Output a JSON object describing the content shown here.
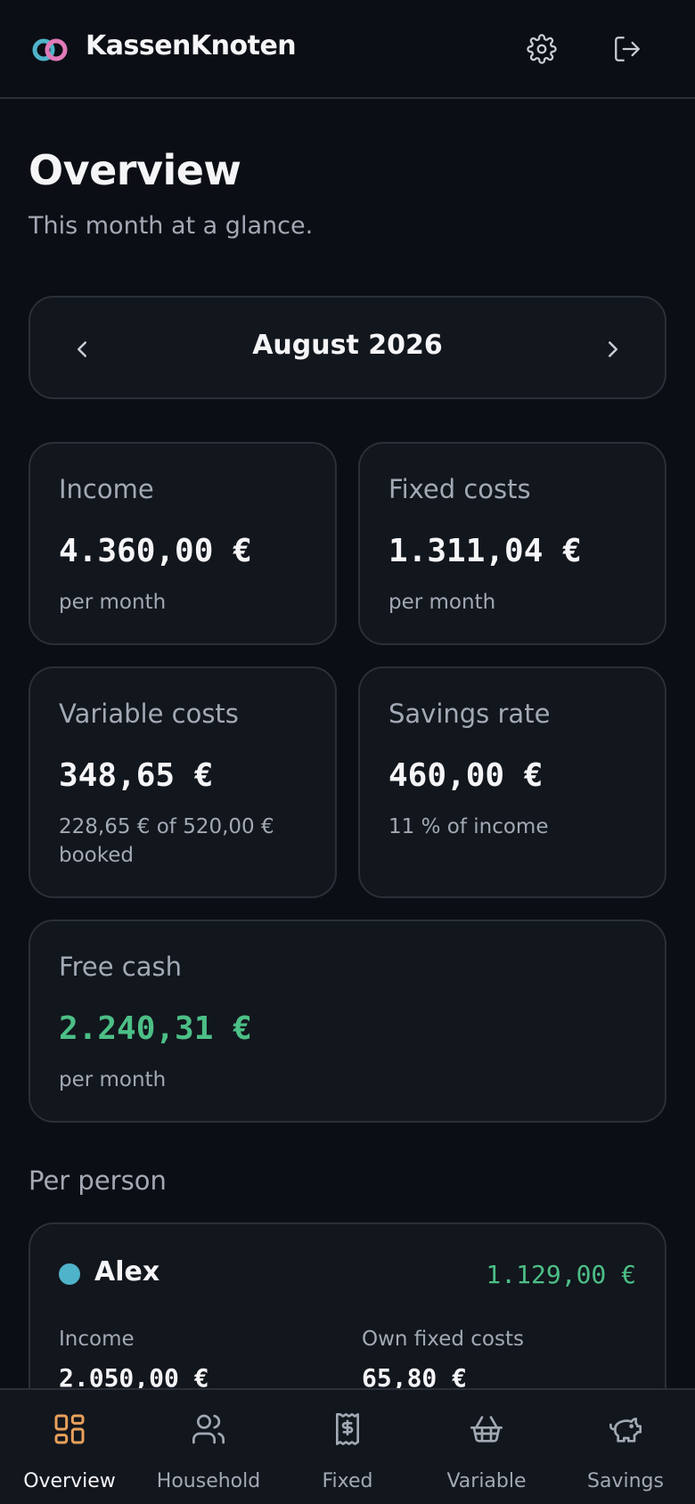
{
  "header": {
    "brand": "KassenKnoten"
  },
  "page": {
    "title": "Overview",
    "subtitle": "This month at a glance."
  },
  "month_nav": {
    "label": "August 2026"
  },
  "cards": {
    "income": {
      "label": "Income",
      "value": "4.360,00 €",
      "note": "per month"
    },
    "fixed": {
      "label": "Fixed costs",
      "value": "1.311,04 €",
      "note": "per month"
    },
    "variable": {
      "label": "Variable costs",
      "value": "348,65 €",
      "note": "228,65 € of 520,00 € booked"
    },
    "savings": {
      "label": "Savings rate",
      "value": "460,00 €",
      "note": "11 % of income"
    },
    "free": {
      "label": "Free cash",
      "value": "2.240,31 €",
      "note": "per month"
    }
  },
  "per_person": {
    "title": "Per person",
    "people": [
      {
        "name": "Alex",
        "total": "1.129,00 €",
        "income_label": "Income",
        "income_value": "2.050,00 €",
        "fixed_label": "Own fixed costs",
        "fixed_value": "65,80 €",
        "color": "#4fb3c9"
      }
    ]
  },
  "bottom_nav": [
    {
      "label": "Overview",
      "icon": "dashboard-icon",
      "active": true
    },
    {
      "label": "Household",
      "icon": "users-icon",
      "active": false
    },
    {
      "label": "Fixed",
      "icon": "receipt-icon",
      "active": false
    },
    {
      "label": "Variable",
      "icon": "basket-icon",
      "active": false
    },
    {
      "label": "Savings",
      "icon": "piggy-bank-icon",
      "active": false
    }
  ],
  "colors": {
    "accent": "#e8a15a",
    "positive": "#4cbf86",
    "background": "#0b0e14",
    "card": "#12161d",
    "logo_ring_a": "#4fb3c9",
    "logo_ring_b": "#e07ab8"
  }
}
